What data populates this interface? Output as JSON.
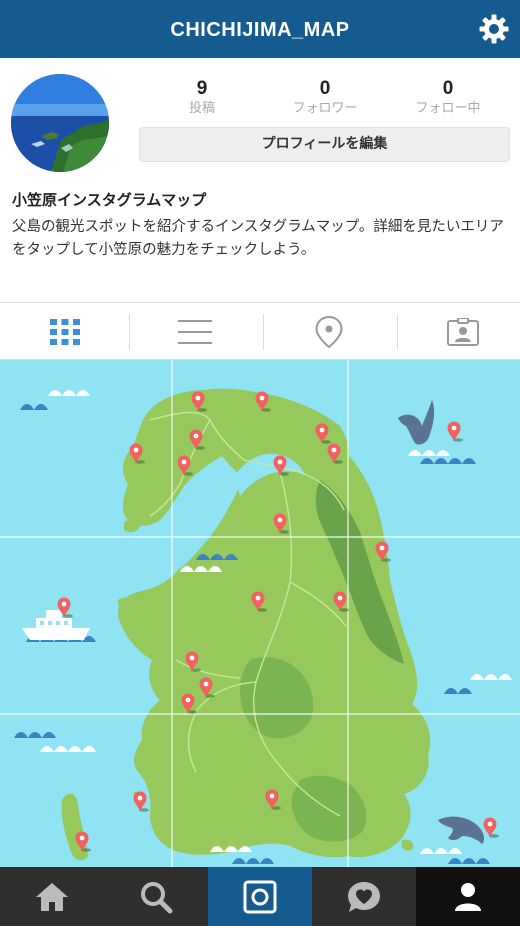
{
  "header": {
    "title": "CHICHIJIMA_MAP",
    "settings_icon": "gear-icon"
  },
  "profile": {
    "stats": [
      {
        "value": "9",
        "label": "投稿"
      },
      {
        "value": "0",
        "label": "フォロワー"
      },
      {
        "value": "0",
        "label": "フォロー中"
      }
    ],
    "edit_button": "プロフィールを編集",
    "name": "小笠原インスタグラムマップ",
    "bio": "父島の観光スポットを紹介するインスタグラムマップ。詳細を見たいエリアをタップして小笠原の魅力をチェックしよう。"
  },
  "tabs": [
    {
      "icon": "grid-icon",
      "active": true
    },
    {
      "icon": "list-icon",
      "active": false
    },
    {
      "icon": "location-pin-icon",
      "active": false
    },
    {
      "icon": "tagged-person-icon",
      "active": false
    }
  ],
  "bottom_nav": [
    {
      "icon": "home-icon"
    },
    {
      "icon": "search-icon"
    },
    {
      "icon": "camera-icon",
      "active": true
    },
    {
      "icon": "activity-heart-icon"
    },
    {
      "icon": "profile-icon",
      "selected": true
    }
  ],
  "colors": {
    "header_bg": "#165b8f",
    "accent_blue": "#3d8fd6",
    "sea": "#8fe3f2",
    "land": "#96c85c",
    "pin": "#f06160",
    "nav_bg": "#2f2f2f"
  }
}
